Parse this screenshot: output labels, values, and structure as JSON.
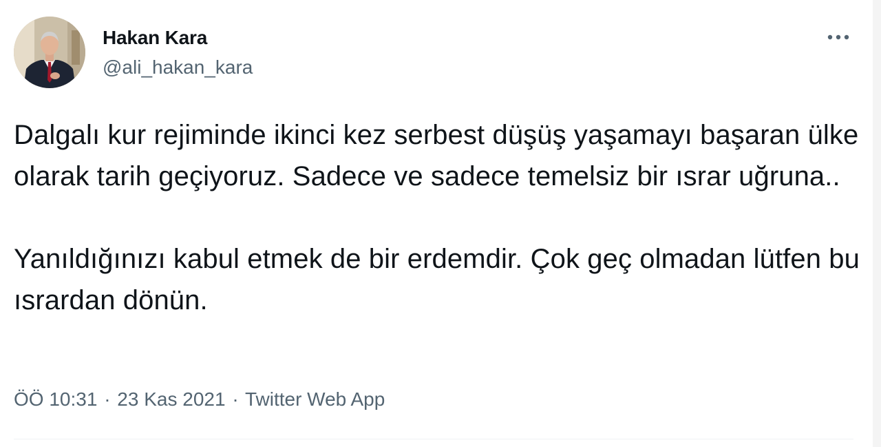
{
  "tweet": {
    "author": {
      "display_name": "Hakan Kara",
      "handle": "@ali_hakan_kara"
    },
    "paragraphs": [
      "Dalgalı kur rejiminde ikinci kez serbest düşüş yaşamayı başaran ülke olarak tarih geçiyoruz. Sadece ve sadece temelsiz bir ısrar uğruna..",
      "Yanıldığınızı kabul etmek de bir erdemdir. Çok geç olmadan lütfen bu ısrardan dönün."
    ],
    "meta": {
      "time": "ÖÖ 10:31",
      "date": "23 Kas 2021",
      "source": "Twitter Web App",
      "separator": "·"
    }
  },
  "colors": {
    "text_primary": "#0f1419",
    "text_secondary": "#536471",
    "divider": "#eff3f4"
  },
  "icons": {
    "more": "more-dots-icon"
  }
}
